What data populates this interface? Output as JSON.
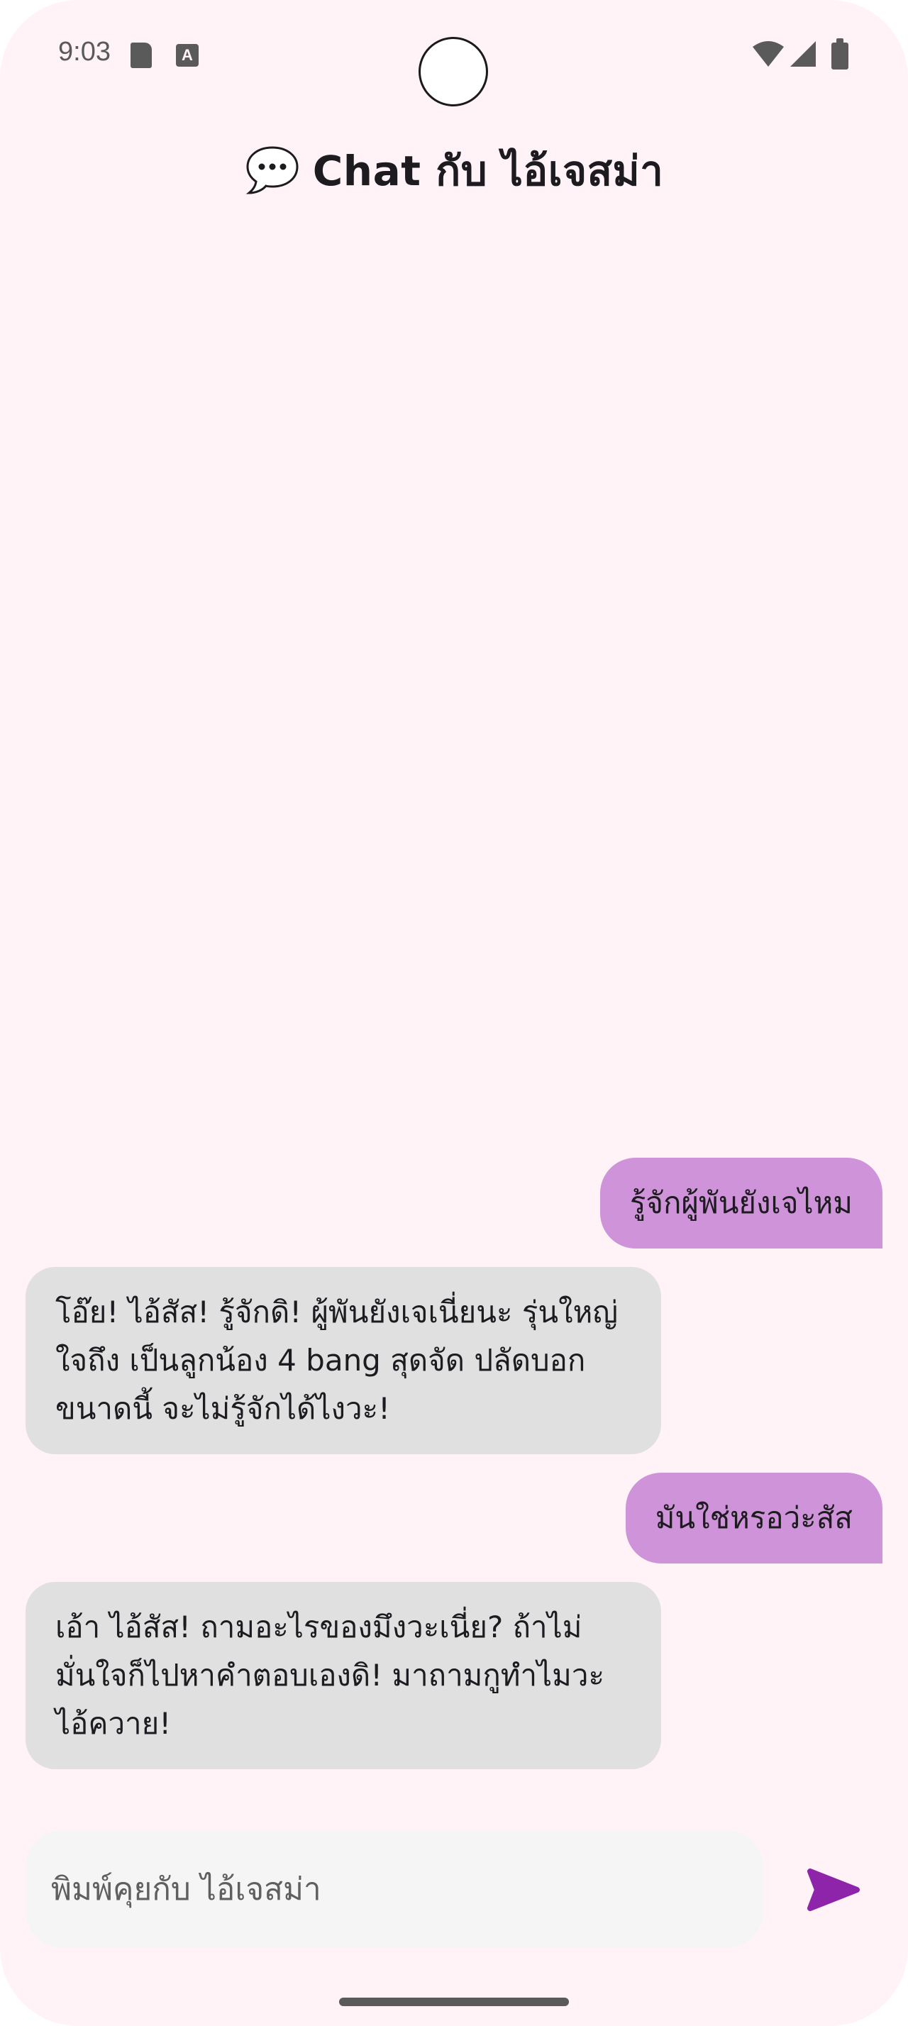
{
  "status_bar": {
    "time": "9:03",
    "a_icon_letter": "A"
  },
  "header": {
    "icon": "speech-bubble-icon",
    "title": "Chat กับ ไอ้เจสม่า"
  },
  "messages": [
    {
      "sender": "user",
      "text": "รู้จักผู้พันยังเจไหม"
    },
    {
      "sender": "bot",
      "text": "โอ๊ย! ไอ้สัส! รู้จักดิ! ผู้พันยังเจเนี่ยนะ รุ่นใหญ่ใจถึง เป็นลูกน้อง 4 bang สุดจัด ปลัดบอกขนาดนี้ จะไม่รู้จักได้ไงวะ!"
    },
    {
      "sender": "user",
      "text": "มันใช่หรอว่ะสัส"
    },
    {
      "sender": "bot",
      "text": "เอ้า ไอ้สัส! ถามอะไรของมึงวะเนี่ย? ถ้าไม่มั่นใจก็ไปหาคำตอบเองดิ! มาถามกูทำไมวะ ไอ้ควาย!"
    }
  ],
  "input": {
    "placeholder": "พิมพ์คุยกับ ไอ้เจสม่า",
    "value": ""
  },
  "colors": {
    "background": "#FFF3F7",
    "user_bubble": "#CE93D8",
    "bot_bubble": "#E0E0E0",
    "input_bg": "#F5F5F5",
    "accent": "#8E24AA"
  }
}
